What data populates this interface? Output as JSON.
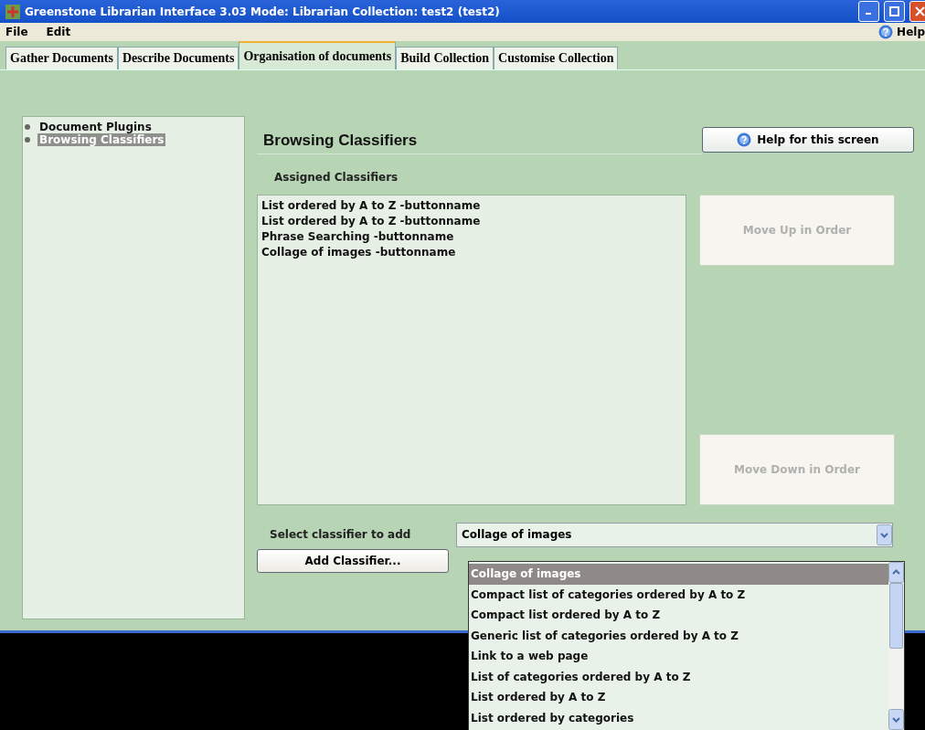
{
  "window": {
    "title": "Greenstone Librarian Interface 3.03  Mode: Librarian  Collection: test2 (test2)"
  },
  "menu": [
    {
      "label": "File"
    },
    {
      "label": "Edit"
    }
  ],
  "help_menu": {
    "label": "Help"
  },
  "tabs": [
    {
      "label": "Gather Documents",
      "selected": false
    },
    {
      "label": "Describe Documents",
      "selected": false
    },
    {
      "label": "Organisation of documents",
      "selected": true
    },
    {
      "label": "Build Collection",
      "selected": false
    },
    {
      "label": "Customise Collection",
      "selected": false
    }
  ],
  "sidebar": {
    "items": [
      {
        "label": "Document Plugins",
        "selected": false
      },
      {
        "label": "Browsing Classifiers",
        "selected": true
      }
    ]
  },
  "heading": "Browsing Classifiers",
  "help_button": "Help for this screen",
  "assigned_label": "Assigned Classifiers",
  "assigned": [
    "List ordered by A to Z -buttonname",
    "List ordered by A to Z -buttonname",
    "Phrase Searching -buttonname",
    "Collage of images -buttonname"
  ],
  "move_up": {
    "label": "Move Up in Order",
    "disabled": true
  },
  "move_down": {
    "label": "Move Down in Order",
    "disabled": true
  },
  "select_label": "Select classifier to add",
  "select_value": "Collage of images",
  "add_button": "Add Classifier...",
  "dropdown": [
    {
      "label": "Collage of images",
      "selected": true
    },
    {
      "label": "Compact list of categories ordered by A to Z",
      "selected": false
    },
    {
      "label": "Compact list ordered by A to Z",
      "selected": false
    },
    {
      "label": "Generic list of categories ordered by A to Z",
      "selected": false
    },
    {
      "label": "Link to a web page",
      "selected": false
    },
    {
      "label": "List of categories ordered by A to Z",
      "selected": false
    },
    {
      "label": "List ordered by A to Z",
      "selected": false
    },
    {
      "label": "List ordered by categories",
      "selected": false
    }
  ]
}
